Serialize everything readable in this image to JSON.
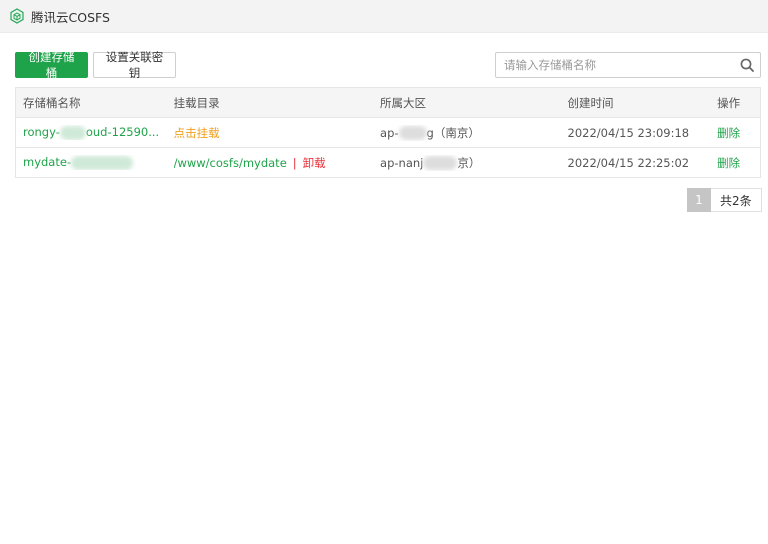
{
  "app": {
    "title": "腾讯云COSFS",
    "accent": "#1fa34a"
  },
  "toolbar": {
    "create_label": "创建存储桶",
    "keys_label": "设置关联密钥"
  },
  "search": {
    "placeholder": "请输入存储桶名称"
  },
  "table": {
    "headers": [
      "存储桶名称",
      "挂载目录",
      "所属大区",
      "创建时间",
      "操作"
    ],
    "rows": [
      {
        "name_a": "rongy-",
        "name_b": "oud-12590...",
        "mount": "点击挂载",
        "region_a": "ap-",
        "region_b": "g（南京）",
        "created": "2022/04/15 23:09:18",
        "action": "删除"
      },
      {
        "name_a": "mydate-",
        "name_b": "",
        "mount": "/www/cosfs/mydate",
        "separator": "|",
        "unmount": "卸载",
        "region_a": "ap-nanj",
        "region_b": "京）",
        "created": "2022/04/15 22:25:02",
        "action": "删除"
      }
    ]
  },
  "pagination": {
    "current": "1",
    "total": "共2条"
  }
}
